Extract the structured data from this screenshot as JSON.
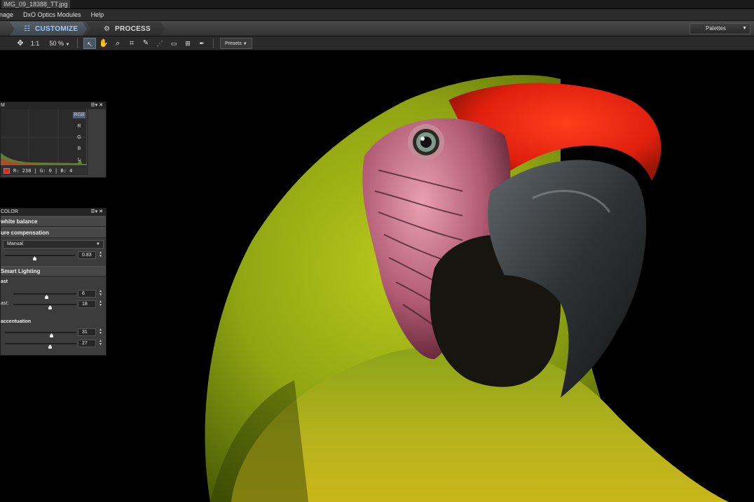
{
  "window": {
    "title": "IMG_09_18388_TT.jpg"
  },
  "menu": [
    "nage",
    "DxO Optics Modules",
    "Help"
  ],
  "modes": {
    "customize": "CUSTOMIZE",
    "process": "PROCESS",
    "palettes_label": "Palettes"
  },
  "toolbar": {
    "zoom_one": "1:1",
    "zoom_level": "50 %",
    "presets": "Presets",
    "icons": [
      "move-icon",
      "arrow-select-icon",
      "hand-icon",
      "zoom-icon",
      "crop-icon",
      "eraser-icon",
      "perspective-icon",
      "horizon-icon",
      "grid-icon",
      "picker-icon"
    ]
  },
  "histogram": {
    "title": "M",
    "channels": [
      "RGB",
      "R",
      "G",
      "B",
      "L"
    ],
    "selected_channel": "RGB",
    "readout": "R: 238 | G:   0 | B:   4",
    "swatch_color": "#e0261e"
  },
  "color_panel": {
    "title": "COLOR",
    "sections": {
      "white_balance": "white balance",
      "exposure": "ure compensation",
      "smart_lighting": "Smart Lighting",
      "contrast": "ast",
      "color_accentuation": "accentuation"
    },
    "exposure_mode": "Manual",
    "exposure_value": "0.83",
    "contrast": {
      "label_a": "",
      "label_b": "ast:",
      "value_a": "6",
      "value_b": "18"
    },
    "accentuation": {
      "value_a": "31",
      "value_b": "27"
    }
  }
}
